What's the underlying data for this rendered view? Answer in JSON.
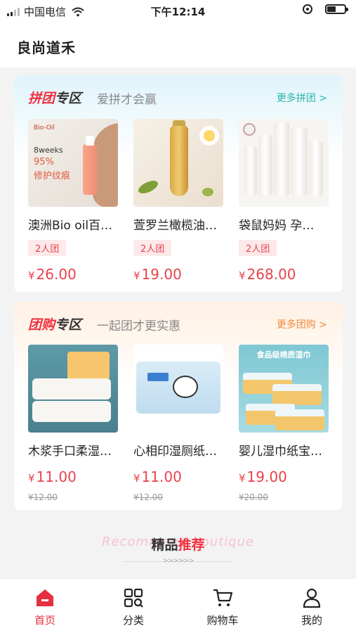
{
  "status_bar": {
    "carrier": "中国电信",
    "time": "下午12:14"
  },
  "app": {
    "title": "良尚道禾"
  },
  "pin_section": {
    "title_highlight": "拼团",
    "title_rest": "专区",
    "subtitle": "爱拼才会赢",
    "more": "更多拼团 >",
    "products": [
      {
        "name": "澳洲Bio oil百…",
        "tag": "2人团",
        "currency": "¥",
        "price": "26.00",
        "image_text": [
          "Bio-Oil",
          "8weeks",
          "95%",
          "修护纹痕"
        ]
      },
      {
        "name": "萱罗兰橄榄油…",
        "tag": "2人团",
        "currency": "¥",
        "price": "19.00"
      },
      {
        "name": "袋鼠妈妈 孕…",
        "tag": "2人团",
        "currency": "¥",
        "price": "268.00"
      }
    ]
  },
  "tuan_section": {
    "title_highlight": "团购",
    "title_rest": "专区",
    "subtitle": "一起团才更实惠",
    "more": "更多团购 >",
    "products": [
      {
        "name": "木浆手口柔湿…",
        "currency": "¥",
        "price": "11.00",
        "old_price": "¥12.00"
      },
      {
        "name": "心相印湿厕纸…",
        "currency": "¥",
        "price": "11.00",
        "old_price": "¥12.00"
      },
      {
        "name": "婴儿湿巾纸宝…",
        "currency": "¥",
        "price": "19.00",
        "old_price": "¥20.00",
        "image_text": "食品级棉质湿巾"
      }
    ]
  },
  "recommend": {
    "bg_text": "Recommend boutique",
    "title_plain": "精品",
    "title_highlight": "推荐",
    "arrows": ">>>>>>"
  },
  "tab_bar": [
    {
      "label": "首页",
      "icon": "home-icon",
      "active": true
    },
    {
      "label": "分类",
      "icon": "category-icon",
      "active": false
    },
    {
      "label": "购物车",
      "icon": "cart-icon",
      "active": false
    },
    {
      "label": "我的",
      "icon": "user-icon",
      "active": false
    }
  ],
  "colors": {
    "accent": "#e5303f",
    "pin_more": "#2cb5a8",
    "tuan_more": "#f08a3c"
  }
}
